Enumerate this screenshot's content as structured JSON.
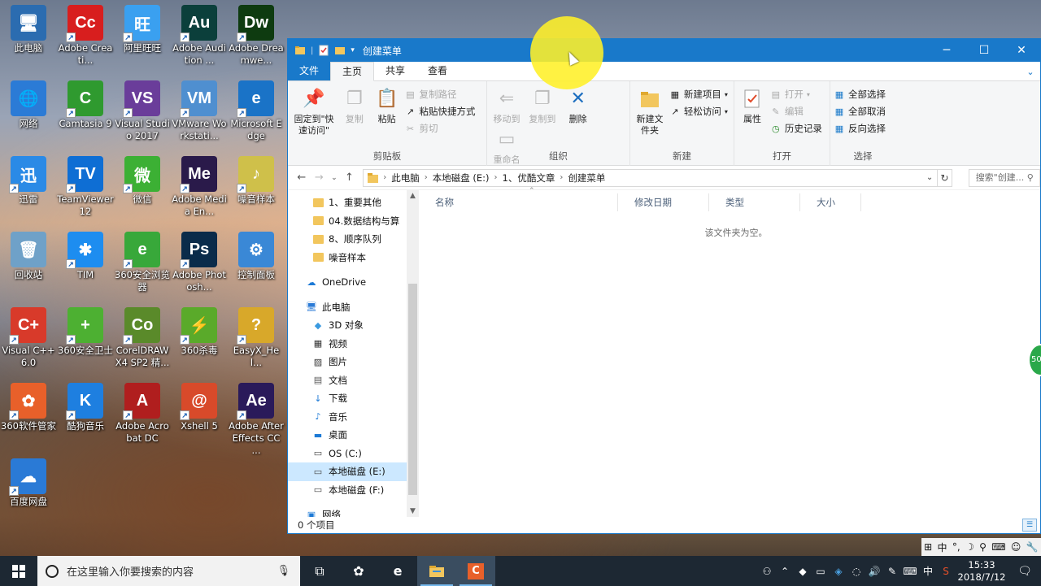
{
  "desktop": {
    "icons": [
      {
        "label": "此电脑",
        "color": "#2b6cb0",
        "glyph": "🖥"
      },
      {
        "label": "Adobe Creati...",
        "color": "#d81e1e",
        "glyph": "Cc"
      },
      {
        "label": "阿里旺旺",
        "color": "#3aa0f0",
        "glyph": "旺"
      },
      {
        "label": "Adobe Audition ...",
        "color": "#0b3f3b",
        "glyph": "Au"
      },
      {
        "label": "Adobe Dreamwe...",
        "color": "#0e3b10",
        "glyph": "Dw"
      },
      {
        "label": "网络",
        "color": "#2b7bd6",
        "glyph": "🌐"
      },
      {
        "label": "Camtasia 9",
        "color": "#2f9a2f",
        "glyph": "C"
      },
      {
        "label": "Visual Studio 2017",
        "color": "#6a3d9a",
        "glyph": "VS"
      },
      {
        "label": "VMware Workstati...",
        "color": "#4f8fd0",
        "glyph": "VM"
      },
      {
        "label": "Microsoft Edge",
        "color": "#1a73c7",
        "glyph": "e"
      },
      {
        "label": "迅雷",
        "color": "#2a8ae6",
        "glyph": "迅"
      },
      {
        "label": "TeamViewer 12",
        "color": "#0e6ed4",
        "glyph": "TV"
      },
      {
        "label": "微信",
        "color": "#3cb034",
        "glyph": "微"
      },
      {
        "label": "Adobe Media En...",
        "color": "#2a1a4a",
        "glyph": "Me"
      },
      {
        "label": "噪音样本",
        "color": "#cfc04a",
        "glyph": "♪"
      },
      {
        "label": "回收站",
        "color": "#6fa1c8",
        "glyph": "🗑"
      },
      {
        "label": "TIM",
        "color": "#1d8df0",
        "glyph": "✱"
      },
      {
        "label": "360安全浏览器",
        "color": "#38a83a",
        "glyph": "e"
      },
      {
        "label": "Adobe Photosh...",
        "color": "#0a2b4a",
        "glyph": "Ps"
      },
      {
        "label": "控制面板",
        "color": "#3a88d6",
        "glyph": "⚙"
      },
      {
        "label": "Visual C++ 6.0",
        "color": "#d83a2a",
        "glyph": "C+"
      },
      {
        "label": "360安全卫士",
        "color": "#4db032",
        "glyph": "+"
      },
      {
        "label": "CorelDRAW X4 SP2 精...",
        "color": "#5a8a2a",
        "glyph": "Co"
      },
      {
        "label": "360杀毒",
        "color": "#5aaa2a",
        "glyph": "⚡"
      },
      {
        "label": "EasyX_Hel...",
        "color": "#d8a82a",
        "glyph": "?"
      },
      {
        "label": "360软件管家",
        "color": "#e8602a",
        "glyph": "✿"
      },
      {
        "label": "酷狗音乐",
        "color": "#1e7fe0",
        "glyph": "K"
      },
      {
        "label": "Adobe Acrobat DC",
        "color": "#b01e1e",
        "glyph": "A"
      },
      {
        "label": "Xshell 5",
        "color": "#d84a2a",
        "glyph": "@"
      },
      {
        "label": "Adobe After Effects CC ...",
        "color": "#2a1a5a",
        "glyph": "Ae"
      },
      {
        "label": "百度网盘",
        "color": "#2a7ad6",
        "glyph": "☁"
      }
    ]
  },
  "window": {
    "title": "创建菜单",
    "tabs": {
      "file": "文件",
      "home": "主页",
      "share": "共享",
      "view": "查看"
    },
    "ribbon": {
      "clipboard": {
        "name": "剪贴板",
        "pin": "固定到\"快速访问\"",
        "copy": "复制",
        "paste": "粘贴",
        "copy_path": "复制路径",
        "paste_shortcut": "粘贴快捷方式",
        "cut": "剪切"
      },
      "organize": {
        "name": "组织",
        "move_to": "移动到",
        "copy_to": "复制到",
        "delete": "删除",
        "rename": "重命名"
      },
      "new": {
        "name": "新建",
        "new_folder": "新建文件夹",
        "new_item": "新建项目",
        "easy_access": "轻松访问"
      },
      "open": {
        "name": "打开",
        "properties": "属性",
        "open": "打开",
        "edit": "编辑",
        "history": "历史记录"
      },
      "select": {
        "name": "选择",
        "select_all": "全部选择",
        "select_none": "全部取消",
        "invert": "反向选择"
      }
    },
    "address": {
      "crumbs": [
        "此电脑",
        "本地磁盘 (E:)",
        "1、优酷文章",
        "创建菜单"
      ],
      "search_placeholder": "搜索\"创建..."
    },
    "nav_items": [
      {
        "label": "1、重要其他",
        "icon": "folder-icon",
        "indent": 1
      },
      {
        "label": "04.数据结构与算",
        "icon": "folder-icon",
        "indent": 1
      },
      {
        "label": "8、顺序队列",
        "icon": "folder-icon",
        "indent": 1
      },
      {
        "label": "噪音样本",
        "icon": "folder-icon",
        "indent": 1
      },
      {
        "label": "",
        "icon": "",
        "indent": 0
      },
      {
        "label": "OneDrive",
        "icon": "cloud-icon",
        "indent": 0
      },
      {
        "label": "",
        "icon": "",
        "indent": 0
      },
      {
        "label": "此电脑",
        "icon": "computer-icon",
        "indent": 0
      },
      {
        "label": "3D 对象",
        "icon": "cube-icon",
        "indent": 1
      },
      {
        "label": "视频",
        "icon": "video-icon",
        "indent": 1
      },
      {
        "label": "图片",
        "icon": "picture-icon",
        "indent": 1
      },
      {
        "label": "文档",
        "icon": "document-icon",
        "indent": 1
      },
      {
        "label": "下载",
        "icon": "download-icon",
        "indent": 1
      },
      {
        "label": "音乐",
        "icon": "music-icon",
        "indent": 1
      },
      {
        "label": "桌面",
        "icon": "desktop-icon",
        "indent": 1
      },
      {
        "label": "OS (C:)",
        "icon": "drive-icon",
        "indent": 1
      },
      {
        "label": "本地磁盘 (E:)",
        "icon": "drive-icon",
        "indent": 1,
        "selected": true
      },
      {
        "label": "本地磁盘 (F:)",
        "icon": "drive-icon",
        "indent": 1
      },
      {
        "label": "",
        "icon": "",
        "indent": 0
      },
      {
        "label": "网络",
        "icon": "network-icon",
        "indent": 0
      }
    ],
    "columns": [
      "名称",
      "修改日期",
      "类型",
      "大小"
    ],
    "empty_text": "该文件夹为空。",
    "status": "0 个项目"
  },
  "taskbar": {
    "search_placeholder": "在这里输入你要搜索的内容",
    "time": "15:33",
    "date": "2018/7/12",
    "ime": "中"
  },
  "side_widget": "50"
}
